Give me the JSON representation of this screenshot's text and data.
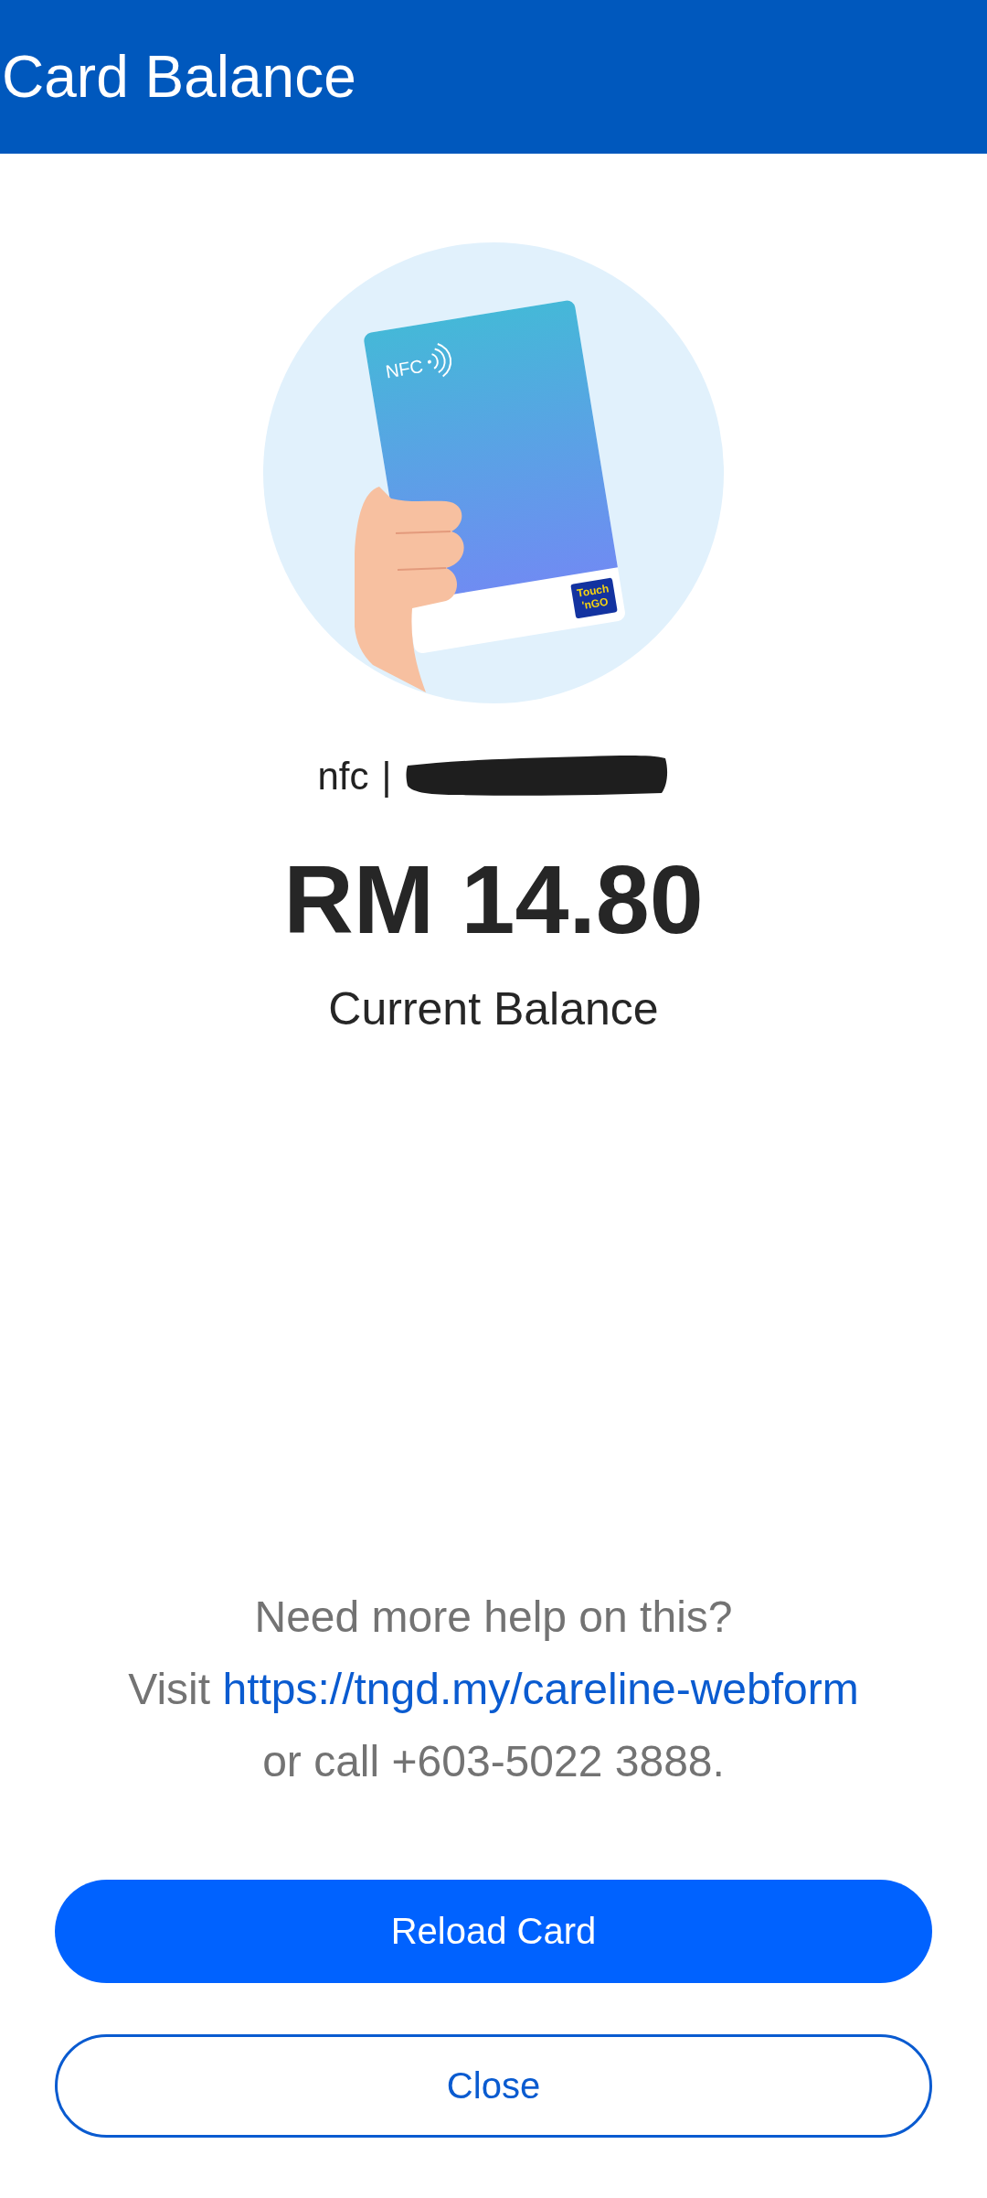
{
  "header": {
    "title": "Card Balance"
  },
  "illustration": {
    "card_label": "NFC",
    "logo_lines": [
      "Touch",
      "'nGO"
    ]
  },
  "card": {
    "type": "nfc",
    "separator": "|",
    "number_redacted": true
  },
  "balance": {
    "amount": "RM 14.80",
    "label": "Current Balance"
  },
  "help": {
    "question": "Need more help on this?",
    "visit_prefix": "Visit",
    "link": "https://tngd.my/careline-webform",
    "call_text": "or call +603-5022 3888."
  },
  "buttons": [
    {
      "label": "Reload Card",
      "kind": "primary"
    },
    {
      "label": "Close",
      "kind": "outline"
    }
  ]
}
